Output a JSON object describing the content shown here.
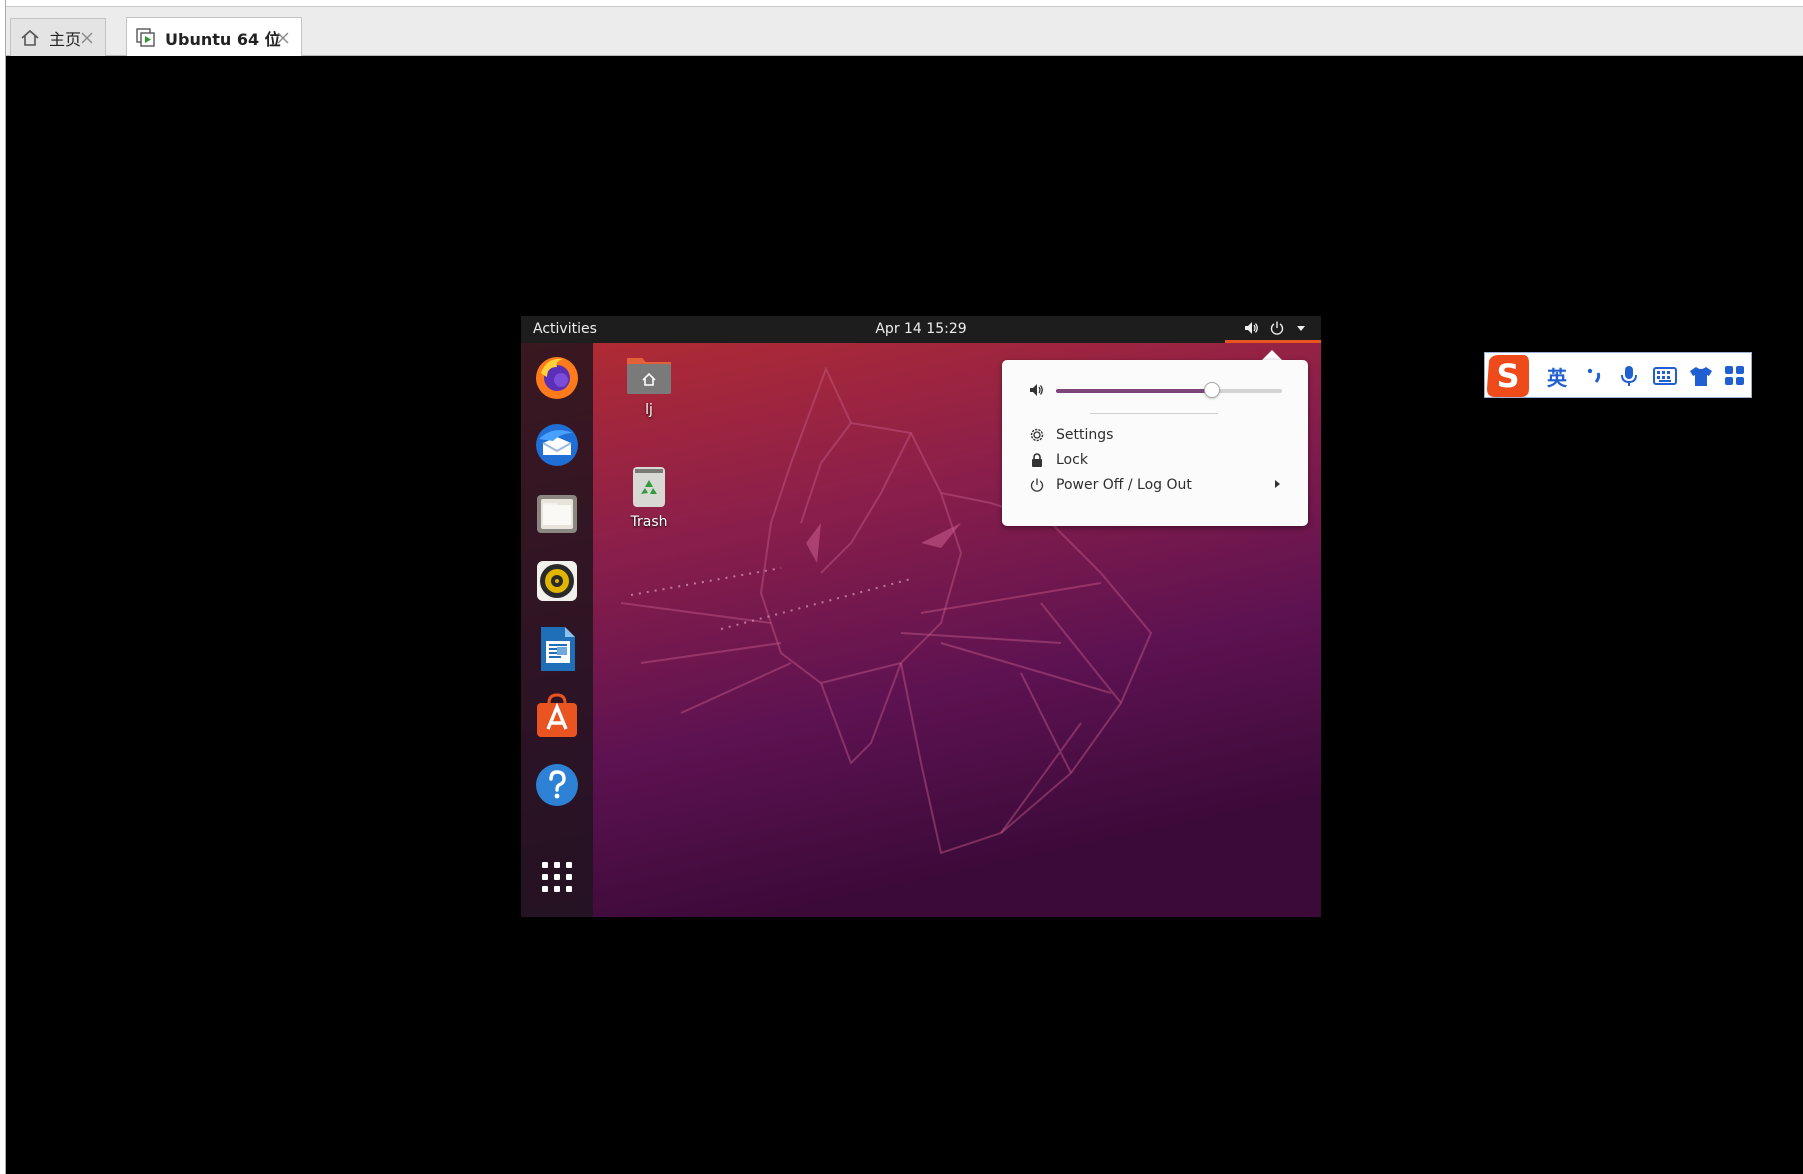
{
  "host": {
    "tabs": [
      {
        "label": "主页",
        "icon": "home-icon",
        "active": false
      },
      {
        "label": "Ubuntu 64 位",
        "icon": "vm-play-icon",
        "active": true
      }
    ]
  },
  "ubuntu": {
    "topbar": {
      "activities": "Activities",
      "clock": "Apr 14  15:29",
      "tray_icons": [
        "volume-icon",
        "power-icon",
        "dropdown-arrow-icon"
      ],
      "accent": "#e95420"
    },
    "dock": {
      "apps": [
        {
          "name": "firefox-icon"
        },
        {
          "name": "thunderbird-icon"
        },
        {
          "name": "files-icon"
        },
        {
          "name": "rhythmbox-icon"
        },
        {
          "name": "libreoffice-writer-icon"
        },
        {
          "name": "software-center-icon"
        },
        {
          "name": "help-icon"
        }
      ],
      "show_apps_icon": "app-grid-icon"
    },
    "desktop_icons": [
      {
        "label": "lj",
        "icon": "home-folder-icon"
      },
      {
        "label": "Trash",
        "icon": "trash-icon"
      }
    ],
    "system_menu": {
      "volume_level": 0.69,
      "items": [
        {
          "label": "Settings",
          "icon": "gear-icon"
        },
        {
          "label": "Lock",
          "icon": "lock-icon"
        },
        {
          "label": "Power Off / Log Out",
          "icon": "power-icon",
          "submenu": true
        }
      ]
    }
  },
  "ime_bar": {
    "logo": "sogou-logo-icon",
    "mode_label": "英",
    "icons": [
      "punctuation-icon",
      "microphone-icon",
      "keyboard-icon",
      "skin-shirt-icon",
      "toolbox-grid-icon"
    ],
    "color": "#1f5fd1"
  }
}
